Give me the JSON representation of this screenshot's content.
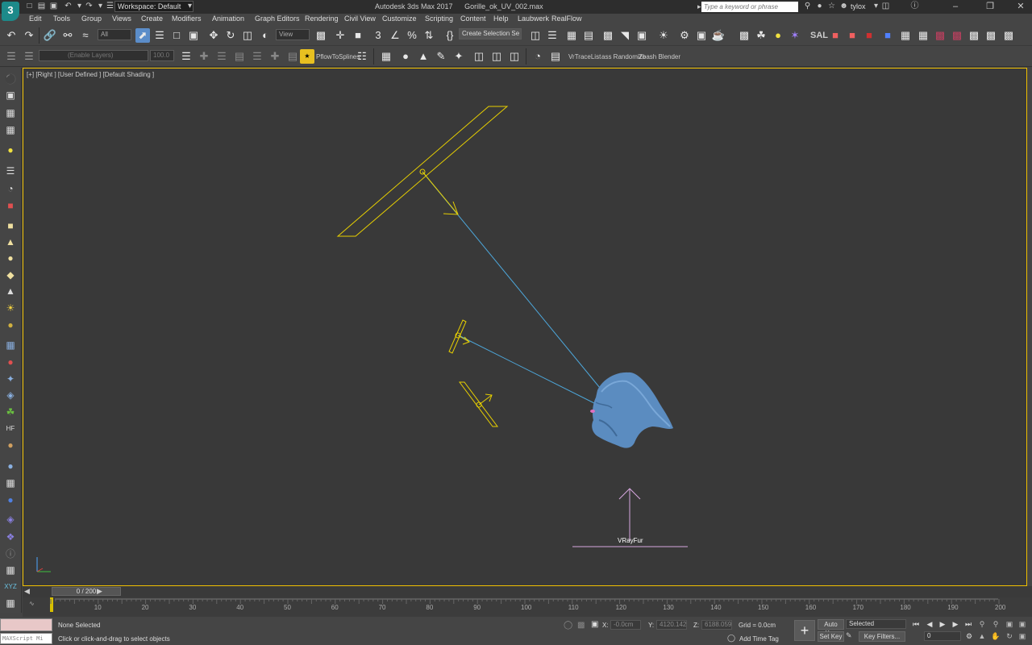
{
  "window": {
    "logo": "3",
    "title_prefix": "Autodesk 3ds Max 2017",
    "filename": "Gorille_ok_UV_002.max",
    "workspace": "Workspace: Default",
    "search_placeholder": "Type a keyword or phrase",
    "user": "tylox"
  },
  "menu": [
    "Edit",
    "Tools",
    "Group",
    "Views",
    "Create",
    "Modifiers",
    "Animation",
    "Graph Editors",
    "Rendering",
    "Civil View",
    "Customize",
    "Scripting",
    "Content",
    "Help",
    "Laubwerk",
    "RealFlow"
  ],
  "toolbar1": {
    "filter_value": "All",
    "view_value": "View",
    "selection_set": "Create Selection Se",
    "sal_label": "SAL"
  },
  "toolbar2": {
    "layer_placeholder": "(Enable Layers)",
    "layer_value": "100.0",
    "pflow_label": "PflowToSplines",
    "vrtrace_label": "VrTraceList",
    "randomizer_label": "ass Randomize",
    "zbash_label": "Zbash Blender"
  },
  "viewport": {
    "label": "[+] [Right ] [User Defined ] [Default Shading ]",
    "vrayfur_label": "VRayFur"
  },
  "timeline": {
    "thumb_label": "0 / 200",
    "ticks": [
      "10",
      "20",
      "30",
      "40",
      "50",
      "60",
      "70",
      "80",
      "90",
      "100",
      "110",
      "120",
      "130",
      "140",
      "150",
      "160",
      "170",
      "180",
      "190",
      "200"
    ]
  },
  "status": {
    "maxscript": "MAXScript Mi",
    "selection": "None Selected",
    "prompt": "Click or click-and-drag to select objects",
    "x_label": "X:",
    "x_value": "-0.0cm",
    "y_label": "Y:",
    "y_value": "4120.142c",
    "z_label": "Z:",
    "z_value": "6188.059c",
    "grid": "Grid = 0.0cm",
    "add_time_tag": "Add Time Tag",
    "auto_key": "Auto Key",
    "set_key": "Set Key",
    "key_mode": "Selected",
    "key_filters": "Key Filters...",
    "frame": "0"
  },
  "colors": {
    "viewport_bg": "#393939",
    "light_yellow": "#e8d000",
    "target_line": "#4da6d9",
    "mesh_blue": "#5b8cc0",
    "vrayfur_pink": "#d8a8e0",
    "active_border": "#f0c000"
  }
}
